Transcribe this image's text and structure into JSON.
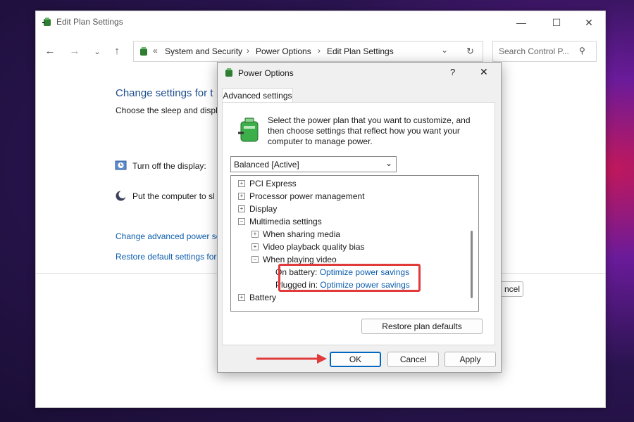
{
  "main": {
    "title": "Edit Plan Settings",
    "breadcrumb_icon": "power-options-icon",
    "breadcrumb_chevrons": "«",
    "breadcrumb": [
      "System and Security",
      "Power Options",
      "Edit Plan Settings"
    ],
    "search_placeholder": "Search Control P...",
    "heading": "Change settings for t",
    "subheading": "Choose the sleep and displa",
    "turn_off_display": "Turn off the display:",
    "put_computer_sleep": "Put the computer to sl",
    "advanced_link": "Change advanced power se",
    "restore_link": "Restore default settings for",
    "cancel_partial": "ncel"
  },
  "dialog": {
    "title": "Power Options",
    "help": "?",
    "tab": "Advanced settings",
    "description": [
      "Select the power plan that you want to customize, and",
      "then choose settings that reflect how you want your",
      "computer to manage power."
    ],
    "plan_selected": "Balanced [Active]",
    "tree": {
      "pci": "PCI Express",
      "processor": "Processor power management",
      "display": "Display",
      "multimedia": "Multimedia settings",
      "sharing": "When sharing media",
      "quality": "Video playback quality bias",
      "playing": "When playing video",
      "battery_label": "On battery:",
      "battery_value": "Optimize power savings",
      "plugged_label": "Plugged in:",
      "plugged_value": "Optimize power savings",
      "battery": "Battery"
    },
    "restore_defaults": "Restore plan defaults",
    "ok": "OK",
    "cancel": "Cancel",
    "apply": "Apply"
  },
  "colors": {
    "highlight": "#e03a3a",
    "link": "#0b5cad",
    "arrow": "#e03a3a"
  }
}
